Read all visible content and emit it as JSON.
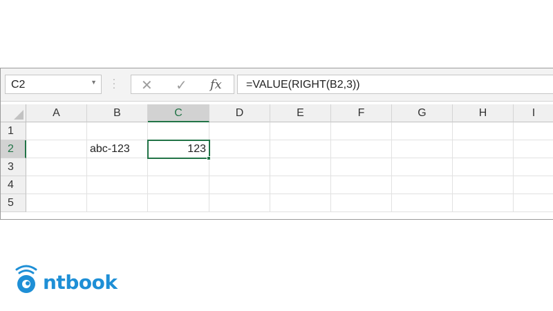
{
  "formula_bar": {
    "name_box": "C2",
    "cancel_icon": "x-icon",
    "enter_icon": "check-icon",
    "function_label": "fx",
    "formula": "=VALUE(RIGHT(B2,3))"
  },
  "columns": [
    "A",
    "B",
    "C",
    "D",
    "E",
    "F",
    "G",
    "H",
    "I"
  ],
  "rows": [
    "1",
    "2",
    "3",
    "4",
    "5"
  ],
  "selected_cell": "C2",
  "cells": {
    "B2": "abc-123",
    "C2": "123"
  },
  "colors": {
    "accent": "#217346",
    "logo": "#1e8fd6"
  },
  "logo": {
    "text": "ntbook"
  }
}
